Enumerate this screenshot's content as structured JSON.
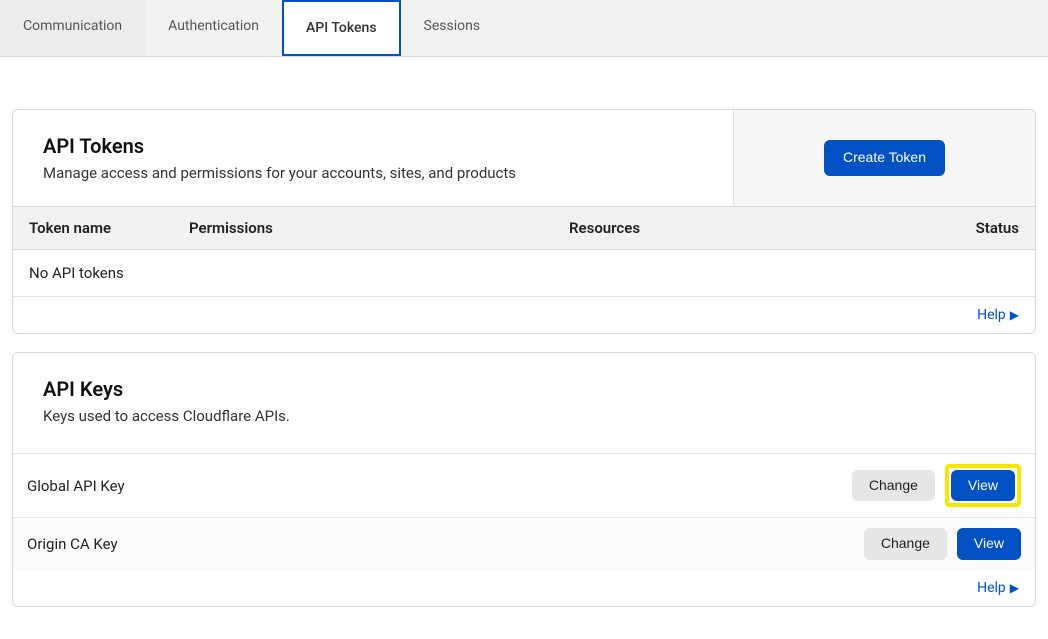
{
  "tabs": {
    "items": [
      {
        "label": "Communication"
      },
      {
        "label": "Authentication"
      },
      {
        "label": "API Tokens"
      },
      {
        "label": "Sessions"
      }
    ],
    "activeIndex": 2
  },
  "apiTokens": {
    "title": "API Tokens",
    "description": "Manage access and permissions for your accounts, sites, and products",
    "createButton": "Create Token",
    "columns": {
      "name": "Token name",
      "permissions": "Permissions",
      "resources": "Resources",
      "status": "Status"
    },
    "emptyMessage": "No API tokens",
    "help": "Help"
  },
  "apiKeys": {
    "title": "API Keys",
    "description": "Keys used to access Cloudflare APIs.",
    "rows": [
      {
        "name": "Global API Key",
        "change": "Change",
        "view": "View",
        "highlightView": true
      },
      {
        "name": "Origin CA Key",
        "change": "Change",
        "view": "View",
        "highlightView": false
      }
    ],
    "help": "Help"
  }
}
